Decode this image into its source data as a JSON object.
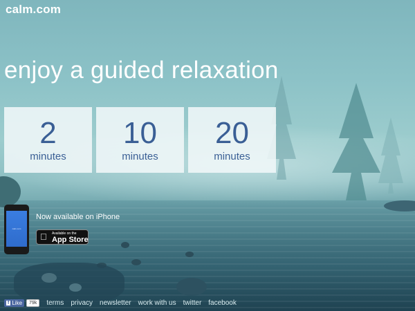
{
  "header": {
    "logo": "calm.com"
  },
  "hero": {
    "headline": "enjoy a guided relaxation"
  },
  "tiles": [
    {
      "number": "2",
      "unit": "minutes"
    },
    {
      "number": "10",
      "unit": "minutes"
    },
    {
      "number": "20",
      "unit": "minutes"
    }
  ],
  "promo": {
    "text": "Now available on iPhone",
    "badge_small": "Available on the",
    "badge_big": "App Store",
    "phone_screen": "calm.com"
  },
  "footer": {
    "like_label": "Like",
    "like_count": "79k",
    "links": [
      "terms",
      "privacy",
      "newsletter",
      "work with us",
      "twitter",
      "facebook"
    ]
  },
  "colors": {
    "tile_text": "#3a5f95",
    "tile_bg": "#f0f7f8",
    "headline": "#ffffff",
    "facebook": "#4a66a0"
  }
}
